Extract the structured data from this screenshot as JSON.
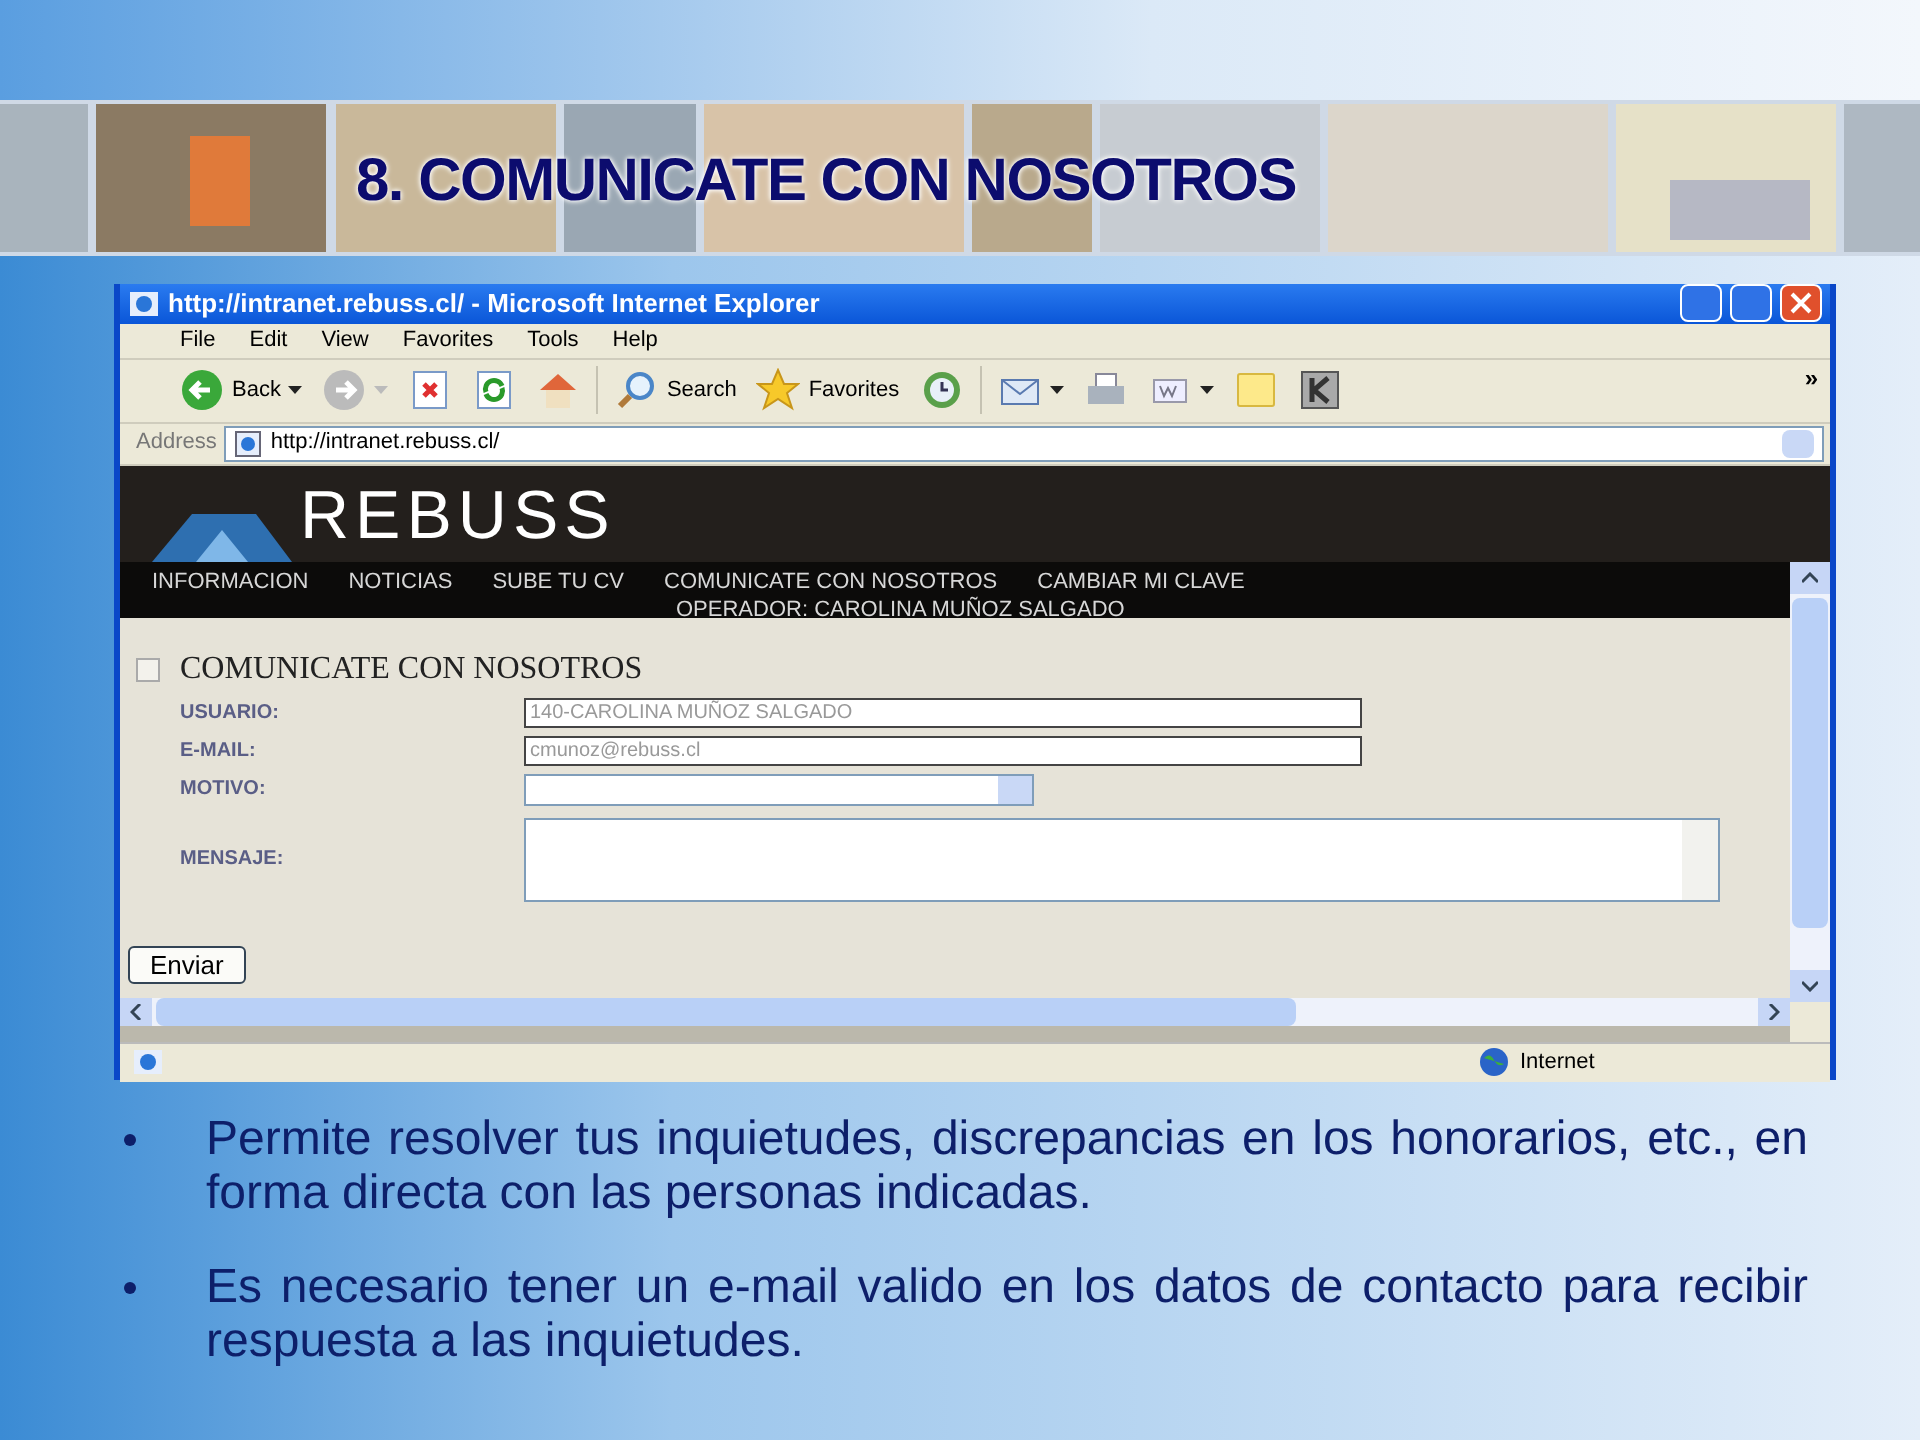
{
  "slide": {
    "title": "8. COMUNICATE CON NOSOTROS",
    "bullets": [
      "Permite resolver tus inquietudes, discrepancias en los honorarios, etc., en forma directa con las personas indicadas.",
      "Es necesario tener un e-mail valido en los datos de contacto para recibir respuesta a las inquietudes."
    ]
  },
  "browser": {
    "title": "http://intranet.rebuss.cl/ - Microsoft Internet Explorer",
    "menu": [
      "File",
      "Edit",
      "View",
      "Favorites",
      "Tools",
      "Help"
    ],
    "toolbar": [
      {
        "kind": "back",
        "label": "Back"
      },
      {
        "kind": "forward"
      },
      {
        "kind": "stop"
      },
      {
        "kind": "refresh"
      },
      {
        "kind": "home"
      },
      {
        "kind": "search",
        "label": "Search"
      },
      {
        "kind": "favorites",
        "label": "Favorites"
      },
      {
        "kind": "history"
      },
      {
        "kind": "mail"
      },
      {
        "kind": "print"
      },
      {
        "kind": "word"
      },
      {
        "kind": "note"
      },
      {
        "kind": "k"
      }
    ],
    "overflow": "»",
    "address_label": "Address",
    "address": "http://intranet.rebuss.cl/",
    "zone": "Internet"
  },
  "page": {
    "logo": "REBUSS",
    "nav": [
      "INFORMACION",
      "NOTICIAS",
      "SUBE TU CV",
      "COMUNICATE CON NOSOTROS",
      "CAMBIAR MI CLAVE"
    ],
    "operator": "OPERADOR: CAROLINA MUÑOZ SALGADO",
    "form_title": "COMUNICATE CON NOSOTROS",
    "form_checked": false,
    "fields": [
      {
        "kind": "text",
        "label": "USUARIO:",
        "value": "140-CAROLINA MUÑOZ SALGADO"
      },
      {
        "kind": "text",
        "label": "E-MAIL:",
        "value": "cmunoz@rebuss.cl"
      },
      {
        "kind": "select",
        "label": "MOTIVO:"
      },
      {
        "kind": "textarea",
        "label": "MENSAJE:"
      }
    ],
    "submit": "Enviar"
  }
}
